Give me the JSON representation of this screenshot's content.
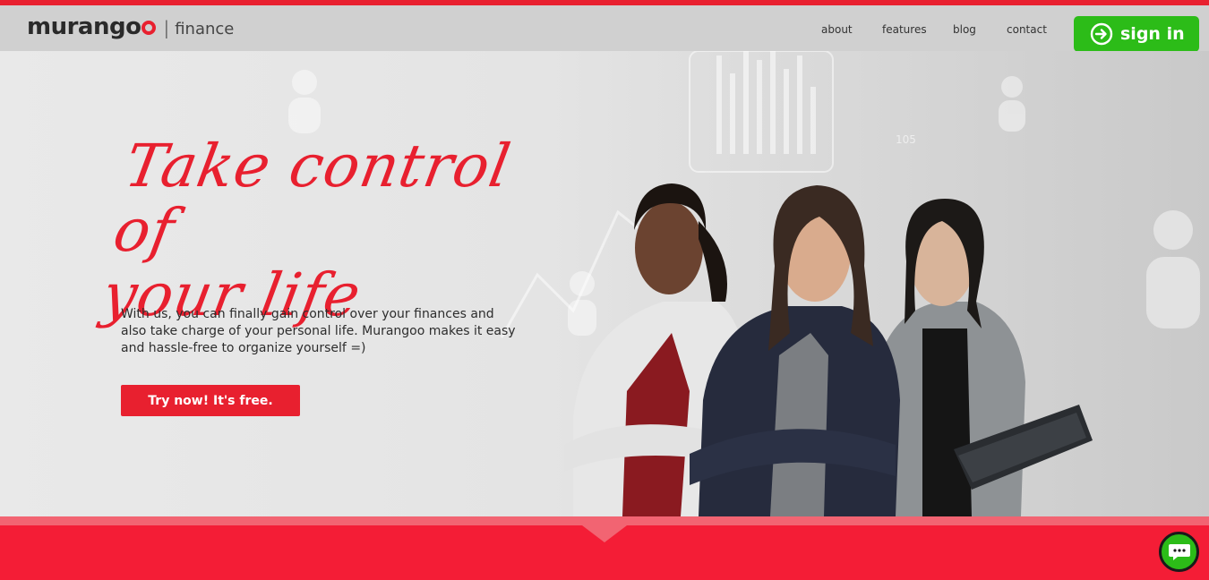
{
  "brand": {
    "name": "murango",
    "separator": "|",
    "product": "finance",
    "accent_color": "#e8202f",
    "green_color": "#2cbc18"
  },
  "nav": {
    "items": [
      {
        "label": "about"
      },
      {
        "label": "features"
      },
      {
        "label": "blog"
      },
      {
        "label": "contact"
      }
    ],
    "signin_label": "sign in",
    "signin_icon": "arrow-circle-icon"
  },
  "hero": {
    "headline_line1": "Take control of",
    "headline_line2": "your life",
    "description": "With us, you can finally gain control over your finances and also take charge of your personal life. Murangoo makes it easy and hassle-free to organize yourself =)",
    "cta_label": "Try now! It's free.",
    "background_chart_label": "105"
  },
  "chat": {
    "icon": "chat-bubble-icon"
  }
}
